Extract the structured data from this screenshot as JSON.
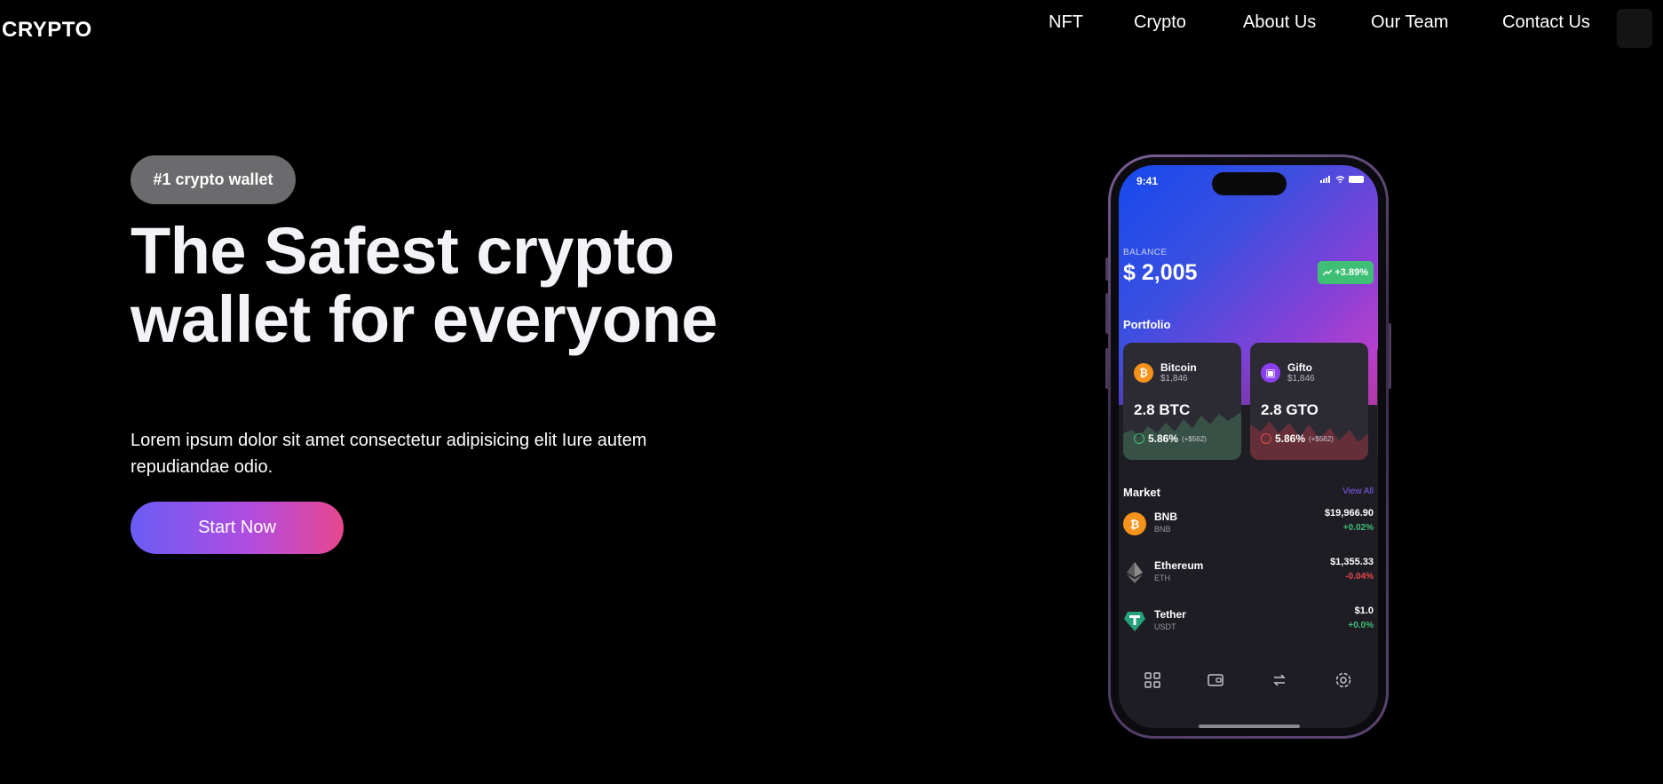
{
  "brand": {
    "logo": "CRYPTO"
  },
  "nav": {
    "items": [
      {
        "label": "NFT"
      },
      {
        "label": "Crypto"
      },
      {
        "label": "About Us"
      },
      {
        "label": "Our Team"
      },
      {
        "label": "Contact Us"
      }
    ]
  },
  "hero": {
    "badge": "#1 crypto wallet",
    "headline": "The Safest crypto wallet for everyone",
    "description": "Lorem ipsum dolor sit amet consectetur adipisicing elit Iure autem repudiandae odio.",
    "cta_label": "Start Now"
  },
  "phone": {
    "status_time": "9:41",
    "balance": {
      "label": "BALANCE",
      "value": "$ 2,005",
      "change": "+3.89%"
    },
    "portfolio": {
      "title": "Portfolio",
      "cards": [
        {
          "name": "Bitcoin",
          "price": "$1,846",
          "amount": "2.8 BTC",
          "change": "5.86%",
          "change_detail": "(+$562)",
          "color": "#f7931a",
          "icon": "bitcoin-icon"
        },
        {
          "name": "Gifto",
          "price": "$1,846",
          "amount": "2.8 GTO",
          "change": "5.86%",
          "change_detail": "(+$562)",
          "color": "#8b3ff0",
          "icon": "gift-icon"
        }
      ]
    },
    "market": {
      "title": "Market",
      "view_all": "View All",
      "rows": [
        {
          "name": "BNB",
          "symbol": "BNB",
          "price": "$19,966.90",
          "change": "+0.02%",
          "positive": true,
          "icon": "bnb-icon"
        },
        {
          "name": "Ethereum",
          "symbol": "ETH",
          "price": "$1,355.33",
          "change": "-0.04%",
          "positive": false,
          "icon": "ethereum-icon"
        },
        {
          "name": "Tether",
          "symbol": "USDT",
          "price": "$1.0",
          "change": "+0.0%",
          "positive": true,
          "icon": "tether-icon"
        }
      ]
    },
    "tabbar": [
      "grid-icon",
      "wallet-icon",
      "swap-icon",
      "settings-icon"
    ]
  },
  "colors": {
    "background": "#000000",
    "badge_bg": "#6b6b6e",
    "cta_gradient_start": "#6a5cf5",
    "cta_gradient_end": "#e8478f",
    "positive": "#3fbf76",
    "negative": "#e5484d",
    "accent_purple": "#7e5cf6"
  }
}
